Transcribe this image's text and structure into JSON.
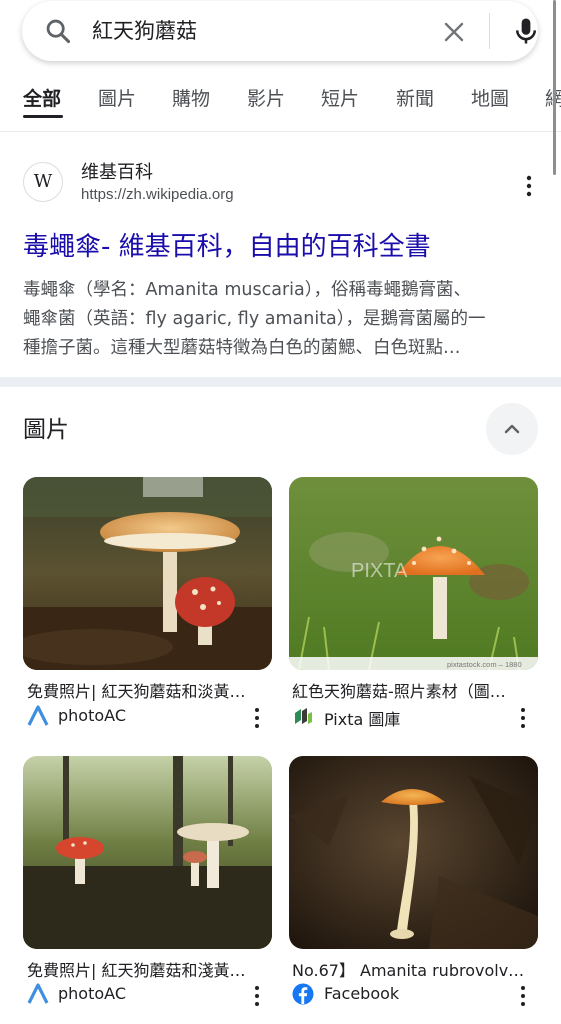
{
  "search": {
    "query": "紅天狗蘑菇"
  },
  "tabs": [
    {
      "label": "全部",
      "active": true
    },
    {
      "label": "圖片"
    },
    {
      "label": "購物"
    },
    {
      "label": "影片"
    },
    {
      "label": "短片"
    },
    {
      "label": "新聞"
    },
    {
      "label": "地圖"
    },
    {
      "label": "網"
    }
  ],
  "result": {
    "site_name": "维基百科",
    "logo_letter": "W",
    "url": "https://zh.wikipedia.org",
    "title": "毒蠅傘- 維基百科，自由的百科全書",
    "snippet_lines": [
      "毒蠅傘（學名：Amanita muscaria），俗稱毒蠅鵝膏菌、",
      "蠅傘菌（英語：fly agaric, fly amanita），是鵝膏菌屬的一",
      "種擔子菌。這種大型蘑菇特徵為白色的菌鰓、白色斑點…"
    ]
  },
  "images_section": {
    "title": "圖片",
    "cards": [
      {
        "title": "免費照片| 紅天狗蘑菇和淡黃…",
        "source": "photoAC",
        "icon": "photoac-icon"
      },
      {
        "title": "紅色天狗蘑菇-照片素材（圖…",
        "source": "Pixta 圖庫",
        "icon": "pixta-icon",
        "watermark": "PIXTA",
        "credit": "pixtastock.com – 1880"
      },
      {
        "title": "免費照片| 紅天狗蘑菇和淺黃…",
        "source": "photoAC",
        "icon": "photoac-icon"
      },
      {
        "title": "No.67】 Amanita rubrovolva…",
        "source": "Facebook",
        "icon": "facebook-icon"
      }
    ]
  },
  "colors": {
    "link": "#1a0dab",
    "photoac": "#3f8fe0",
    "facebook": "#1877f2",
    "section_separator": "#ebeef2"
  }
}
